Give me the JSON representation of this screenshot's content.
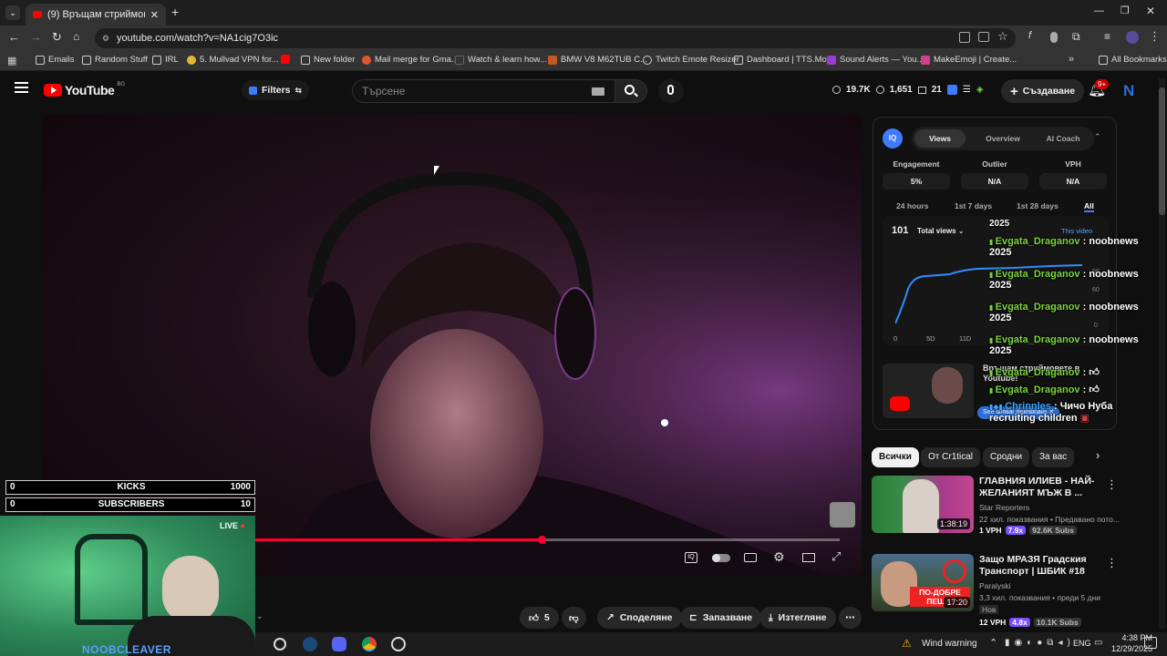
{
  "browser": {
    "tab_title": "(9) Връщам стриймовете в",
    "url": "youtube.com/watch?v=NA1cig7O3ic",
    "bookmarks": [
      "Emails",
      "Random Stuff",
      "IRL",
      "5. Mullvad VPN for...",
      "New folder",
      "Mail merge for Gma...",
      "Watch & learn how...",
      "BMW V8 M62TUB C...",
      "Twitch Emote Resizer",
      "Dashboard | TTS.Mo...",
      "Sound Alerts — You...",
      "MakeEmoji | Create..."
    ],
    "all_bookmarks": "All Bookmarks"
  },
  "youtube": {
    "logo": "YouTube",
    "region": "BG",
    "filters": "Filters",
    "search_placeholder": "Търсене",
    "stats": {
      "views": "19.7K",
      "likes": "1,651",
      "comments": "21"
    },
    "create": "Създаване",
    "notif_badge": "9+"
  },
  "iq_panel": {
    "logo": "IQ",
    "tabs": [
      "Views",
      "Overview",
      "AI Coach"
    ],
    "metrics": [
      {
        "label": "Engagement",
        "value": "5%"
      },
      {
        "label": "Outlier",
        "value": "N/A"
      },
      {
        "label": "VPH",
        "value": "N/A"
      }
    ],
    "periods": [
      "24 hours",
      "1st 7 days",
      "1st 28 days",
      "All"
    ],
    "count": "101",
    "dropdown": "Total views",
    "this_video": "This video",
    "x_ticks": [
      "0",
      "5D",
      "11D"
    ],
    "y_ticks": [
      "90",
      "60",
      "0"
    ],
    "video_title": "Връщам стриймовете в Youtube!",
    "see_similar": "See similar thumbnails"
  },
  "chat": [
    {
      "pre": "2025"
    },
    {
      "name": "Evgata_Draganov",
      "msg": ": noobnews",
      "cont": "2025"
    },
    {
      "name": "Evgata_Draganov",
      "msg": ": noobnews",
      "cont": "2025"
    },
    {
      "name": "Evgata_Draganov",
      "msg": ": noobnews",
      "cont": "2025"
    },
    {
      "name": "Evgata_Draganov",
      "msg": ": noobnews",
      "cont": "2025"
    },
    {
      "name": "Evgata_Draganov",
      "msg": ":"
    },
    {
      "name": "Evgata_Draganov",
      "msg": ":"
    },
    {
      "name": "Chrinnles",
      "msg": ": Чичо Нуба",
      "cont": "recruiting children"
    }
  ],
  "chips": [
    "Всички",
    "От Cr1tical",
    "Сродни",
    "За вас"
  ],
  "recommendations": [
    {
      "title": "ГЛАВНИЯ ИЛИЕВ - НАЙ-ЖЕЛАНИЯТ МЪЖ В ...",
      "channel": "Star Reporters",
      "meta": "22 хил. показвания • Предавано пото...",
      "duration": "1:38:19",
      "vph": "1 VPH",
      "mult": "7.9x",
      "subs": "92.6K Subs"
    },
    {
      "title": "Защо МРАЗЯ Градския Транспорт | ШБИК #18",
      "channel": "Paralyski",
      "meta": "3,3 хил. показвания • преди 5 дни",
      "badge": "Нов",
      "duration": "17:20",
      "thumb_text": "ПО-ДОБРЕ ПЕША!",
      "vph": "12 VPH",
      "mult": "4.8x",
      "subs": "10.1K Subs"
    }
  ],
  "actions": {
    "likes": "5",
    "share": "Споделяне",
    "save": "Запазване",
    "download": "Изтегляне"
  },
  "overlay": {
    "kicks": {
      "value": "0",
      "label": "KICKS",
      "goal": "1000"
    },
    "subs": {
      "value": "0",
      "label": "SUBSCRIBERS",
      "goal": "10"
    },
    "live": "LIVE",
    "streamer": "NOOBCLEAVER"
  },
  "taskbar": {
    "weather": "Wind warning",
    "lang": "ENG",
    "time": "4:38 PM",
    "date": "12/29/2025"
  },
  "colors": {
    "accent": "#3ea6ff",
    "red": "#ff0033",
    "purple": "#7b4cff",
    "green": "#7bd43f"
  }
}
